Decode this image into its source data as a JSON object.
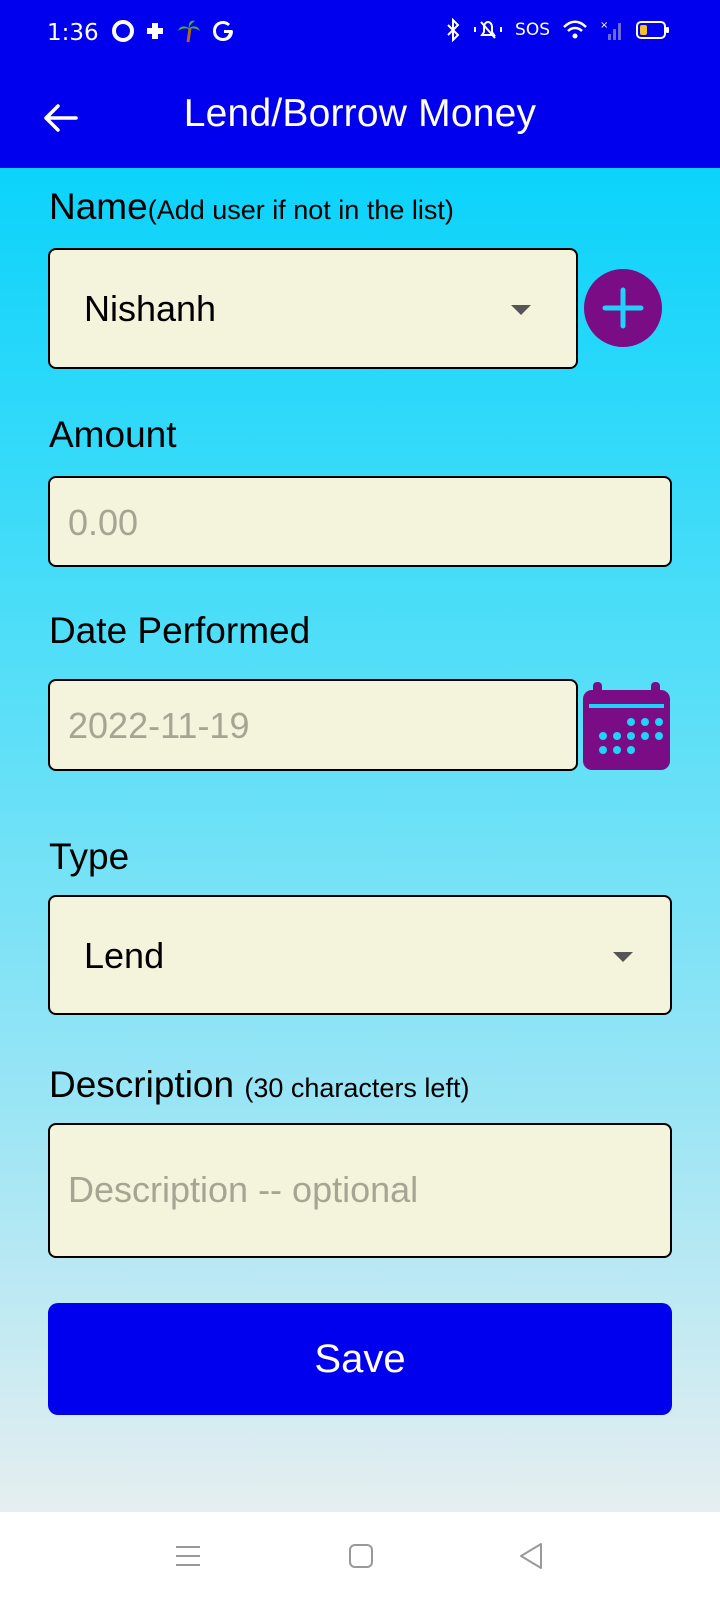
{
  "status_bar": {
    "time": "1:36",
    "sos": "SOS"
  },
  "app_bar": {
    "title": "Lend/Borrow Money"
  },
  "form": {
    "name": {
      "label": "Name",
      "hint": "(Add user if not in the list)",
      "selected": "Nishanh"
    },
    "amount": {
      "label": "Amount",
      "placeholder": "0.00"
    },
    "date": {
      "label": "Date Performed",
      "placeholder": "2022-11-19"
    },
    "type": {
      "label": "Type",
      "selected": "Lend"
    },
    "description": {
      "label": "Description",
      "hint": "(30 characters left)",
      "placeholder": "Description -- optional"
    },
    "save_label": "Save"
  },
  "colors": {
    "primary": "#0000EE",
    "accent": "#7A0C86",
    "field_bg": "#F4F4DC"
  },
  "icons": {
    "back": "arrow-left-icon",
    "add_user": "plus-icon",
    "calendar": "calendar-icon",
    "nav_menu": "menu-icon",
    "nav_home": "square-icon",
    "nav_back": "triangle-back-icon"
  }
}
